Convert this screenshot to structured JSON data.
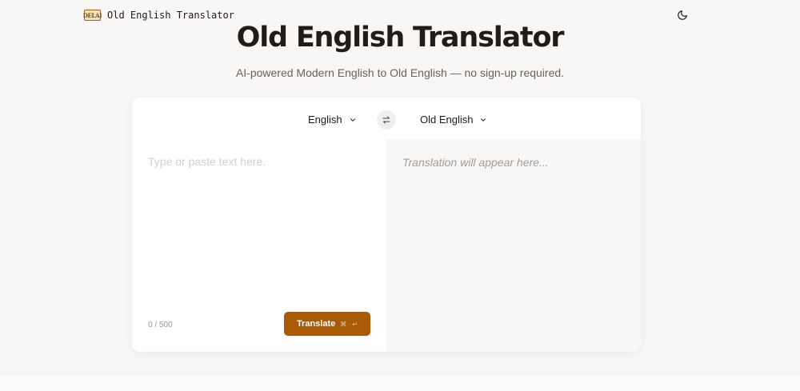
{
  "header": {
    "logo_text": "DELAI",
    "brand_name": "Old English Translator",
    "theme_toggle_icon": "moon-icon"
  },
  "hero": {
    "title": "Old English Translator",
    "subtitle": "AI-powered Modern English to Old English — no sign-up required."
  },
  "translator": {
    "source_language": "English",
    "target_language": "Old English",
    "swap_icon": "swap-arrows-icon",
    "input_placeholder": "Type or paste text here.",
    "input_value": "",
    "char_count": "0 / 500",
    "translate_label": "Translate",
    "shortcut_hint": "⌘ · ↵",
    "output_placeholder": "Translation will appear here..."
  },
  "colors": {
    "accent": "#a95a07",
    "page_bg": "#f8f7f6",
    "card_bg": "#ffffff",
    "output_bg": "#f8f7f6"
  }
}
